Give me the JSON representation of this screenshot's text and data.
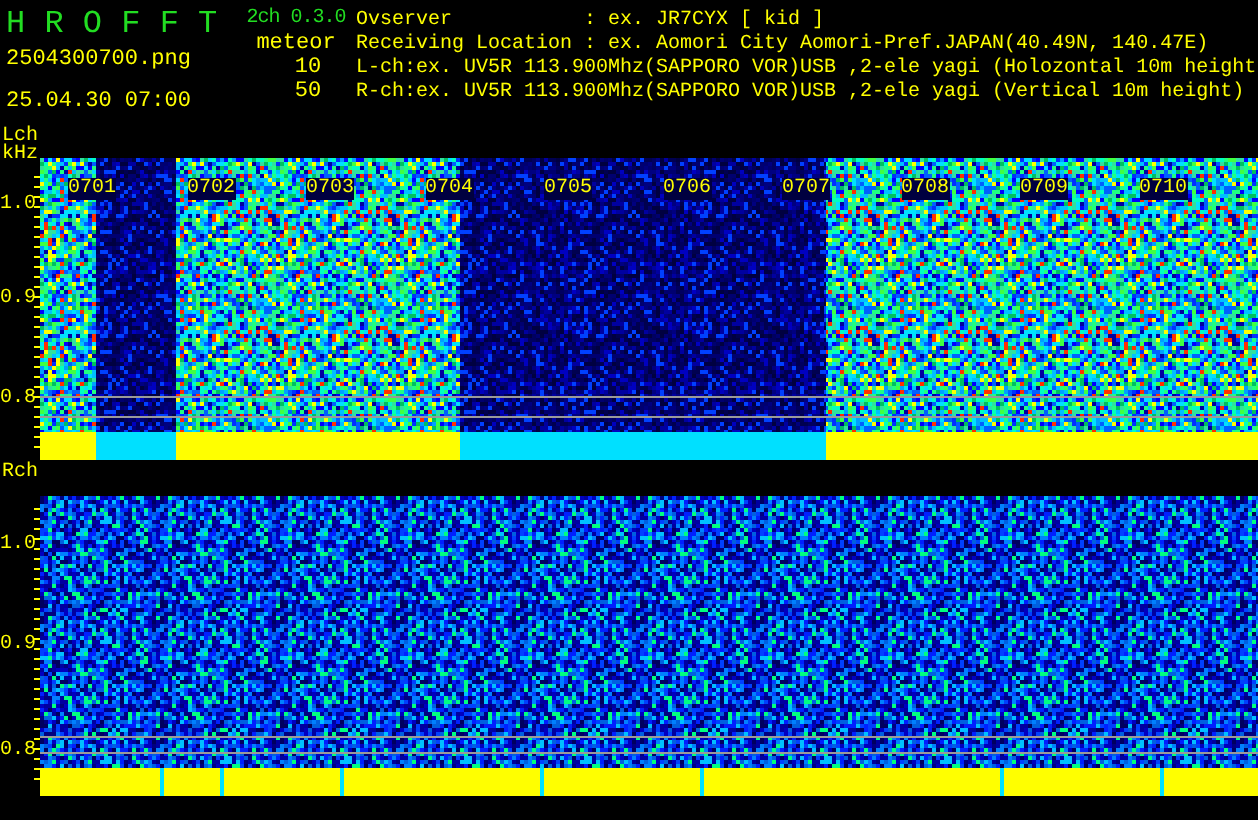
{
  "app": {
    "name": "H R O F F T",
    "version": "2ch 0.3.0",
    "file": "2504300700.png",
    "datetime": "25.04.30 07:00",
    "mode": "meteor",
    "values": [
      "10",
      "50"
    ]
  },
  "info": [
    "Ovserver           : ex. JR7CYX [ kid ]",
    "Receiving Location : ex. Aomori City Aomori-Pref.JAPAN(40.49N, 140.47E)",
    "L-ch:ex. UV5R 113.900Mhz(SAPPORO VOR)USB ,2-ele yagi (Holozontal 10m height",
    "R-ch:ex. UV5R 113.900Mhz(SAPPORO VOR)USB ,2-ele yagi (Vertical 10m height)"
  ],
  "channels": [
    {
      "label": "Lch",
      "unit": "kHz",
      "ticks": [
        "1.0",
        "0.9",
        "0.8"
      ],
      "time_labels": [
        "0701",
        "0702",
        "0703",
        "0704",
        "0705",
        "0706",
        "0707",
        "0708",
        "0709",
        "0710"
      ]
    },
    {
      "label": "Rch",
      "ticks": [
        "1.0",
        "0.9",
        "0.8"
      ]
    }
  ]
}
